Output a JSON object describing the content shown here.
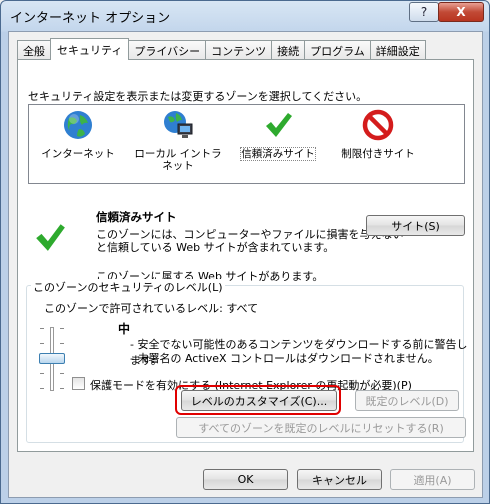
{
  "window": {
    "title": "インターネット オプション",
    "help_label": "?",
    "close_label": "X"
  },
  "tabs": [
    {
      "label": "全般"
    },
    {
      "label": "セキュリティ",
      "active": true
    },
    {
      "label": "プライバシー"
    },
    {
      "label": "コンテンツ"
    },
    {
      "label": "接続"
    },
    {
      "label": "プログラム"
    },
    {
      "label": "詳細設定"
    }
  ],
  "security": {
    "instruction": "セキュリティ設定を表示または変更するゾーンを選択してください。",
    "zones": [
      {
        "label": "インターネット",
        "icon": "globe-icon"
      },
      {
        "label": "ローカル イントラネット",
        "icon": "intranet-icon"
      },
      {
        "label": "信頼済みサイト",
        "icon": "checkmark-icon",
        "selected": true
      },
      {
        "label": "制限付きサイト",
        "icon": "restricted-icon"
      }
    ],
    "zone_title": "信頼済みサイト",
    "zone_desc_1": "このゾーンには、コンピューターやファイルに損害を与えない",
    "zone_desc_2": "と信頼している Web サイトが含まれています。",
    "zone_note": "このゾーンに属する Web サイトがあります。",
    "sites_button": "サイト(S)",
    "group_title": "このゾーンのセキュリティのレベル(L)",
    "allowed_levels": "このゾーンで許可されているレベル: すべて",
    "level_name": "中",
    "bullet_1": "- 安全でない可能性のあるコンテンツをダウンロードする前に警告します。",
    "bullet_2": "- 未署名の ActiveX コントロールはダウンロードされません。",
    "protected_mode": "保護モードを有効にする (Internet Explorer の再起動が必要)(P)",
    "custom_level_button": "レベルのカスタマイズ(C)...",
    "default_level_button": "既定のレベル(D)",
    "reset_all_button": "すべてのゾーンを既定のレベルにリセットする(R)"
  },
  "footer": {
    "ok": "OK",
    "cancel": "キャンセル",
    "apply": "適用(A)"
  },
  "colors": {
    "highlight": "#e00000",
    "check_green": "#2eaa2e",
    "restrict_red": "#d41c1c"
  }
}
